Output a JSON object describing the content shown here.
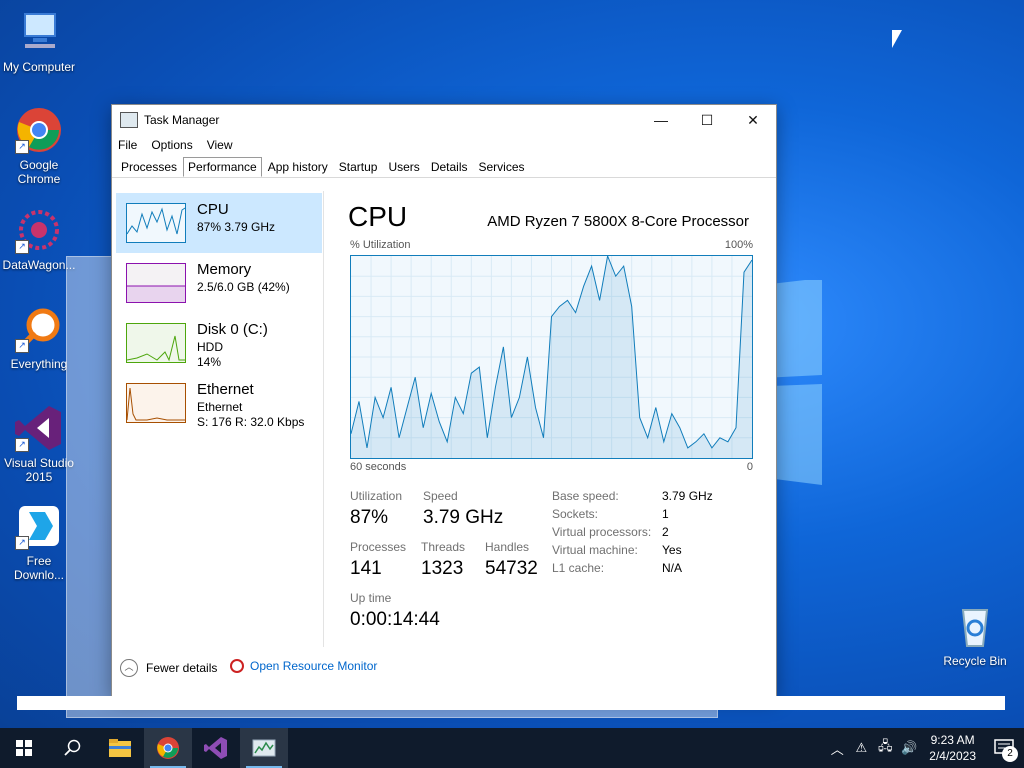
{
  "desktop": {
    "icons": [
      {
        "label": "My Computer"
      },
      {
        "label": "Google Chrome"
      },
      {
        "label": "DataWagon..."
      },
      {
        "label": "Everything"
      },
      {
        "label": "Visual Studio 2015"
      },
      {
        "label": "Free Downlo..."
      },
      {
        "label": "Recycle Bin"
      }
    ]
  },
  "task_manager": {
    "title": "Task Manager",
    "menu": [
      "File",
      "Options",
      "View"
    ],
    "tabs": [
      "Processes",
      "Performance",
      "App history",
      "Startup",
      "Users",
      "Details",
      "Services"
    ],
    "active_tab": "Performance",
    "left_items": [
      {
        "name": "CPU",
        "line1": "87%  3.79 GHz",
        "line2": ""
      },
      {
        "name": "Memory",
        "line1": "2.5/6.0 GB (42%)",
        "line2": ""
      },
      {
        "name": "Disk 0 (C:)",
        "line1": "HDD",
        "line2": "14%"
      },
      {
        "name": "Ethernet",
        "line1": "Ethernet",
        "line2": "S: 176  R: 32.0 Kbps"
      }
    ],
    "detail": {
      "heading": "CPU",
      "model": "AMD Ryzen 7 5800X 8-Core Processor",
      "graph_label_left": "% Utilization",
      "graph_label_right": "100%",
      "axis_left": "60 seconds",
      "axis_right": "0",
      "stats": {
        "utilization_label": "Utilization",
        "utilization": "87%",
        "speed_label": "Speed",
        "speed": "3.79 GHz",
        "processes_label": "Processes",
        "processes": "141",
        "threads_label": "Threads",
        "threads": "1323",
        "handles_label": "Handles",
        "handles": "54732",
        "uptime_label": "Up time",
        "uptime": "0:00:14:44"
      },
      "specs": [
        {
          "label": "Base speed:",
          "value": "3.79 GHz"
        },
        {
          "label": "Sockets:",
          "value": "1"
        },
        {
          "label": "Virtual processors:",
          "value": "2"
        },
        {
          "label": "Virtual machine:",
          "value": "Yes"
        },
        {
          "label": "L1 cache:",
          "value": "N/A"
        }
      ],
      "cpu_history_percent": [
        12,
        28,
        5,
        30,
        20,
        35,
        10,
        25,
        40,
        15,
        32,
        18,
        8,
        30,
        22,
        42,
        45,
        10,
        35,
        55,
        20,
        30,
        50,
        25,
        10,
        70,
        75,
        78,
        72,
        85,
        95,
        78,
        100,
        90,
        95,
        75,
        20,
        10,
        25,
        8,
        22,
        15,
        5,
        8,
        12,
        5,
        10,
        8,
        15,
        92,
        98
      ]
    },
    "footer": {
      "fewer_details": "Fewer details",
      "open_monitor": "Open Resource Monitor"
    }
  },
  "taskbar": {
    "time": "9:23 AM",
    "date": "2/4/2023",
    "notification_count": "2"
  }
}
